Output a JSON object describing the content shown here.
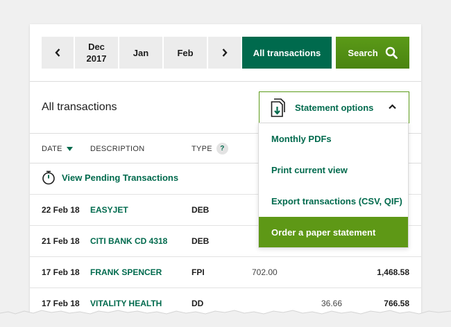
{
  "toolbar": {
    "prev_month_label": "",
    "months": [
      {
        "line1": "Dec",
        "line2": "2017"
      },
      {
        "line1": "Jan",
        "line2": ""
      },
      {
        "line1": "Feb",
        "line2": ""
      }
    ],
    "all_transactions_label": "All transactions",
    "search_label": "Search"
  },
  "heading": "All transactions",
  "statement_options": {
    "label": "Statement options",
    "items": [
      "Monthly PDFs",
      "Print current view",
      "Export transactions (CSV, QIF)",
      "Order a paper statement"
    ]
  },
  "columns": {
    "date": "DATE",
    "description": "DESCRIPTION",
    "type": "TYPE",
    "type_help": "?"
  },
  "pending_label": "View Pending Transactions",
  "rows": [
    {
      "date": "22 Feb 18",
      "description": "EASYJET",
      "type": "DEB",
      "in": "",
      "out": "",
      "balance": ""
    },
    {
      "date": "21 Feb 18",
      "description": "CITI BANK CD 4318",
      "type": "DEB",
      "in": "",
      "out": "",
      "balance": ""
    },
    {
      "date": "17 Feb 18",
      "description": "FRANK SPENCER",
      "type": "FPI",
      "in": "702.00",
      "out": "",
      "balance": "1,468.58"
    },
    {
      "date": "17 Feb 18",
      "description": "VITALITY HEALTH",
      "type": "DD",
      "in": "",
      "out": "36.66",
      "balance": "766.58"
    }
  ],
  "colors": {
    "primary_green": "#006a4d",
    "accent_green": "#5e9816"
  }
}
